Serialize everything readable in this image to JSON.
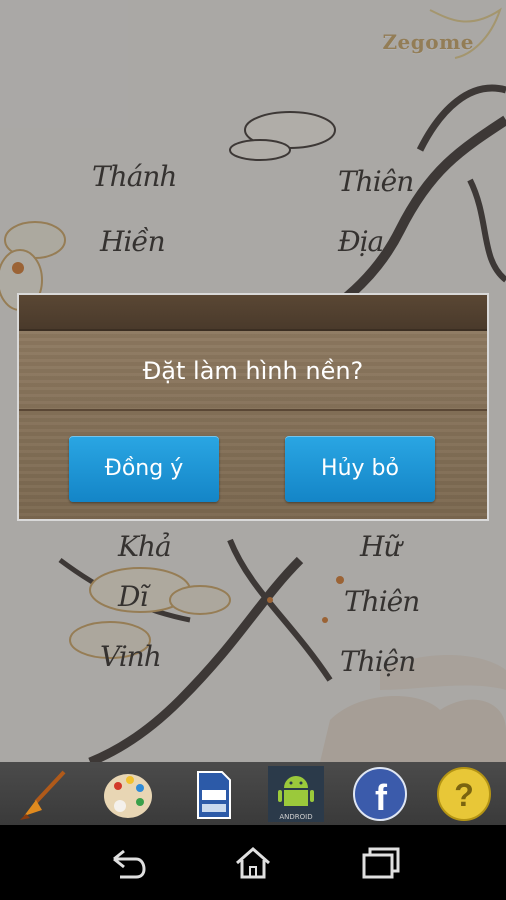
{
  "wallpaper": {
    "logo": "Zegome",
    "calligraphy_left": [
      "Thánh",
      "Hiền",
      "Khả",
      "Dĩ",
      "Vinh"
    ],
    "calligraphy_right": [
      "Thiên",
      "Địa",
      "Hữ",
      "Thiên",
      "Thiện"
    ]
  },
  "dialog": {
    "message": "Đặt làm hình nền?",
    "confirm_label": "Đồng ý",
    "cancel_label": "Hủy bỏ"
  },
  "toolbar": {
    "items": [
      {
        "icon": "brush-icon"
      },
      {
        "icon": "palette-icon"
      },
      {
        "icon": "sd-card-icon"
      },
      {
        "icon": "android-icon"
      },
      {
        "icon": "facebook-icon"
      },
      {
        "icon": "help-icon",
        "label": "?"
      }
    ],
    "android_label": "ANDROID",
    "facebook_label": "f"
  },
  "navbar": {
    "buttons": [
      "back-icon",
      "home-icon",
      "recent-apps-icon"
    ]
  },
  "colors": {
    "button_blue": "#1d93d4",
    "dialog_wood": "#7b6850",
    "toolbar_bg": "#424242"
  }
}
